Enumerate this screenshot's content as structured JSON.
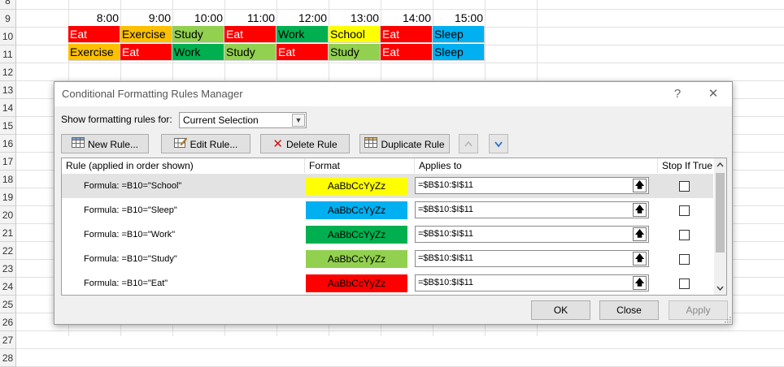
{
  "sheet": {
    "rows": [
      "8",
      "9",
      "10",
      "11",
      "12",
      "13",
      "14",
      "15",
      "16",
      "17",
      "18",
      "19",
      "20",
      "21",
      "22",
      "23",
      "24",
      "25",
      "26",
      "27",
      "28"
    ],
    "times": [
      "8:00",
      "9:00",
      "10:00",
      "11:00",
      "12:00",
      "13:00",
      "14:00",
      "15:00"
    ],
    "row10": [
      {
        "text": "Eat",
        "bg": "#ff0000",
        "fg": "#ffffff"
      },
      {
        "text": "Exercise",
        "bg": "#ffc000",
        "fg": "#000000"
      },
      {
        "text": "Study",
        "bg": "#92d050",
        "fg": "#000000"
      },
      {
        "text": "Eat",
        "bg": "#ff0000",
        "fg": "#ffffff"
      },
      {
        "text": "Work",
        "bg": "#00b050",
        "fg": "#000000"
      },
      {
        "text": "School",
        "bg": "#ffff00",
        "fg": "#000000"
      },
      {
        "text": "Eat",
        "bg": "#ff0000",
        "fg": "#ffffff"
      },
      {
        "text": "Sleep",
        "bg": "#00b0f0",
        "fg": "#000000"
      }
    ],
    "row11": [
      {
        "text": "Exercise",
        "bg": "#ffc000",
        "fg": "#000000"
      },
      {
        "text": "Eat",
        "bg": "#ff0000",
        "fg": "#ffffff"
      },
      {
        "text": "Work",
        "bg": "#00b050",
        "fg": "#000000"
      },
      {
        "text": "Study",
        "bg": "#92d050",
        "fg": "#000000"
      },
      {
        "text": "Eat",
        "bg": "#ff0000",
        "fg": "#ffffff"
      },
      {
        "text": "Study",
        "bg": "#92d050",
        "fg": "#000000"
      },
      {
        "text": "Eat",
        "bg": "#ff0000",
        "fg": "#ffffff"
      },
      {
        "text": "Sleep",
        "bg": "#00b0f0",
        "fg": "#000000"
      }
    ]
  },
  "dialog": {
    "title": "Conditional Formatting Rules Manager",
    "help": "?",
    "close": "✕",
    "show_label": "Show formatting rules for:",
    "show_value": "Current Selection",
    "toolbar": {
      "new_rule": "New Rule...",
      "edit_rule": "Edit Rule...",
      "delete_rule": "Delete Rule",
      "duplicate_rule": "Duplicate Rule"
    },
    "columns": {
      "rule": "Rule (applied in order shown)",
      "format": "Format",
      "applies": "Applies to",
      "stop": "Stop If True"
    },
    "rules": [
      {
        "formula": "Formula: =B10=\"School\"",
        "preview": "AaBbCcYyZz",
        "bg": "#ffff00",
        "fg": "#000000",
        "applies": "=$B$10:$I$11",
        "selected": true
      },
      {
        "formula": "Formula: =B10=\"Sleep\"",
        "preview": "AaBbCcYyZz",
        "bg": "#00b0f0",
        "fg": "#000000",
        "applies": "=$B$10:$I$11",
        "selected": false
      },
      {
        "formula": "Formula: =B10=\"Work\"",
        "preview": "AaBbCcYyZz",
        "bg": "#00b050",
        "fg": "#000000",
        "applies": "=$B$10:$I$11",
        "selected": false
      },
      {
        "formula": "Formula: =B10=\"Study\"",
        "preview": "AaBbCcYyZz",
        "bg": "#92d050",
        "fg": "#000000",
        "applies": "=$B$10:$I$11",
        "selected": false
      },
      {
        "formula": "Formula: =B10=\"Eat\"",
        "preview": "AaBbCcYyZz",
        "bg": "#ff0000",
        "fg": "#000000",
        "applies": "=$B$10:$I$11",
        "selected": false
      }
    ],
    "buttons": {
      "ok": "OK",
      "close": "Close",
      "apply": "Apply"
    }
  }
}
